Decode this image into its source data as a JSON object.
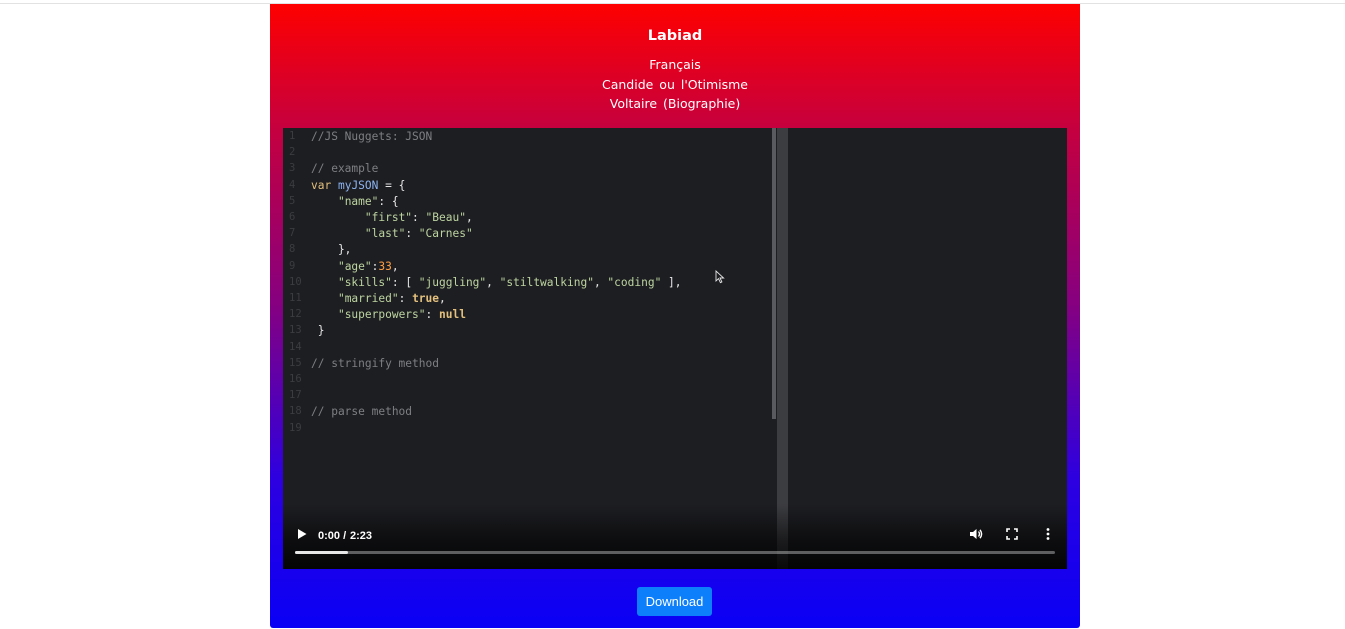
{
  "header": {
    "title": "Labiad",
    "language": "Français",
    "book": "Candide ou l'Otimisme",
    "author": "Voltaire (Biographie)"
  },
  "video": {
    "current_time": "0:00 /",
    "duration": "2:23",
    "progress_fraction": 0.07,
    "line_numbers": [
      "1",
      "2",
      "3",
      "4",
      "5",
      "6",
      "7",
      "8",
      "9",
      "10",
      "11",
      "12",
      "13",
      "14",
      "15",
      "16",
      "17",
      "18",
      "19"
    ],
    "code_lines": [
      [
        {
          "t": "//JS Nuggets: JSON",
          "c": "cm"
        }
      ],
      [],
      [
        {
          "t": "// example",
          "c": "cm"
        }
      ],
      [
        {
          "t": "var",
          "c": "kw"
        },
        {
          "t": " "
        },
        {
          "t": "myJSON",
          "c": "vr"
        },
        {
          "t": " = {"
        }
      ],
      [
        {
          "t": "    "
        },
        {
          "t": "\"name\"",
          "c": "st"
        },
        {
          "t": ": {"
        }
      ],
      [
        {
          "t": "        "
        },
        {
          "t": "\"first\"",
          "c": "st"
        },
        {
          "t": ": "
        },
        {
          "t": "\"Beau\"",
          "c": "st"
        },
        {
          "t": ","
        }
      ],
      [
        {
          "t": "        "
        },
        {
          "t": "\"last\"",
          "c": "st"
        },
        {
          "t": ": "
        },
        {
          "t": "\"Carnes\"",
          "c": "st"
        }
      ],
      [
        {
          "t": "    },"
        }
      ],
      [
        {
          "t": "    "
        },
        {
          "t": "\"age\"",
          "c": "st"
        },
        {
          "t": ":"
        },
        {
          "t": "33",
          "c": "nm"
        },
        {
          "t": ","
        }
      ],
      [
        {
          "t": "    "
        },
        {
          "t": "\"skills\"",
          "c": "st"
        },
        {
          "t": ": [ "
        },
        {
          "t": "\"juggling\"",
          "c": "st"
        },
        {
          "t": ", "
        },
        {
          "t": "\"stiltwalking\"",
          "c": "st"
        },
        {
          "t": ", "
        },
        {
          "t": "\"coding\"",
          "c": "st"
        },
        {
          "t": " ],"
        }
      ],
      [
        {
          "t": "    "
        },
        {
          "t": "\"married\"",
          "c": "st"
        },
        {
          "t": ": "
        },
        {
          "t": "true",
          "c": "vb"
        },
        {
          "t": ","
        }
      ],
      [
        {
          "t": "    "
        },
        {
          "t": "\"superpowers\"",
          "c": "st"
        },
        {
          "t": ": "
        },
        {
          "t": "null",
          "c": "vb"
        }
      ],
      [
        {
          "t": " }"
        }
      ],
      [],
      [
        {
          "t": "// stringify method",
          "c": "cm"
        }
      ],
      [],
      [],
      [
        {
          "t": "// parse method",
          "c": "cm"
        }
      ],
      []
    ]
  },
  "download_label": "Download",
  "colors": {
    "gradient_top": "#fe0000",
    "gradient_bottom": "#0a00f5",
    "button": "#0d7ffb",
    "editor_bg": "#1d1e22"
  },
  "icons": [
    "play-icon",
    "volume-icon",
    "fullscreen-icon",
    "more-options-icon",
    "mouse-cursor-icon"
  ]
}
